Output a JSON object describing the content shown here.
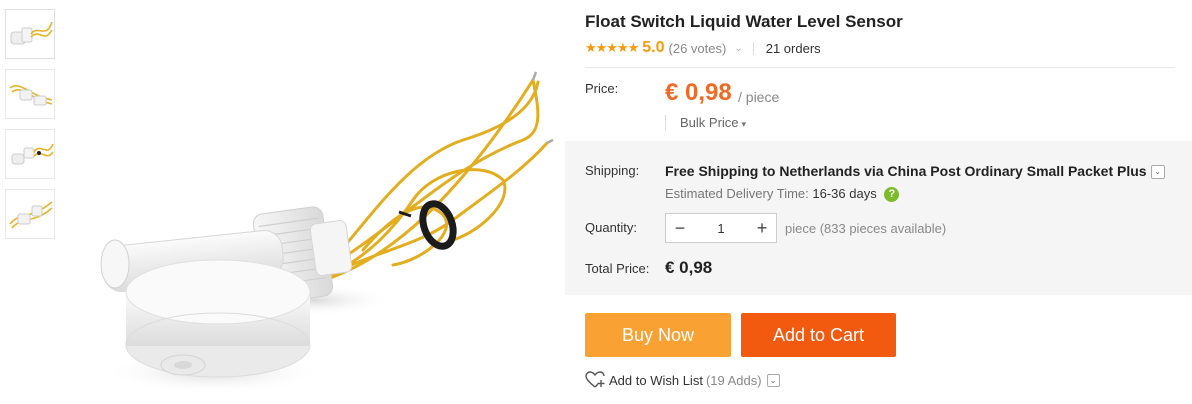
{
  "product": {
    "title": "Float Switch Liquid Water Level Sensor",
    "stars": "★★★★★",
    "rating": "5.0",
    "votes": "(26 votes)",
    "orders": "21 orders"
  },
  "price": {
    "label": "Price:",
    "value": "€ 0,98",
    "unit": "/ piece",
    "bulk_label": "Bulk Price",
    "bulk_arrow": "▾"
  },
  "shipping": {
    "label": "Shipping:",
    "text": "Free Shipping to Netherlands via China Post Ordinary Small Packet Plus",
    "drop": "⌄",
    "delivery_label": "Estimated Delivery Time:",
    "delivery_days": "16-36 days",
    "help": "?"
  },
  "quantity": {
    "label": "Quantity:",
    "minus": "−",
    "value": "1",
    "plus": "+",
    "note": "piece (833 pieces available)"
  },
  "total": {
    "label": "Total Price:",
    "value": "€ 0,98"
  },
  "actions": {
    "buy_now": "Buy Now",
    "add_to_cart": "Add to Cart",
    "wish_label": "Add to Wish List",
    "wish_adds": "(19 Adds)",
    "wish_drop": "⌄"
  },
  "colors": {
    "accent": "#f06a25",
    "buy_button": "#f9a233",
    "cart_button": "#f25a0f",
    "star": "#f59b0f"
  }
}
